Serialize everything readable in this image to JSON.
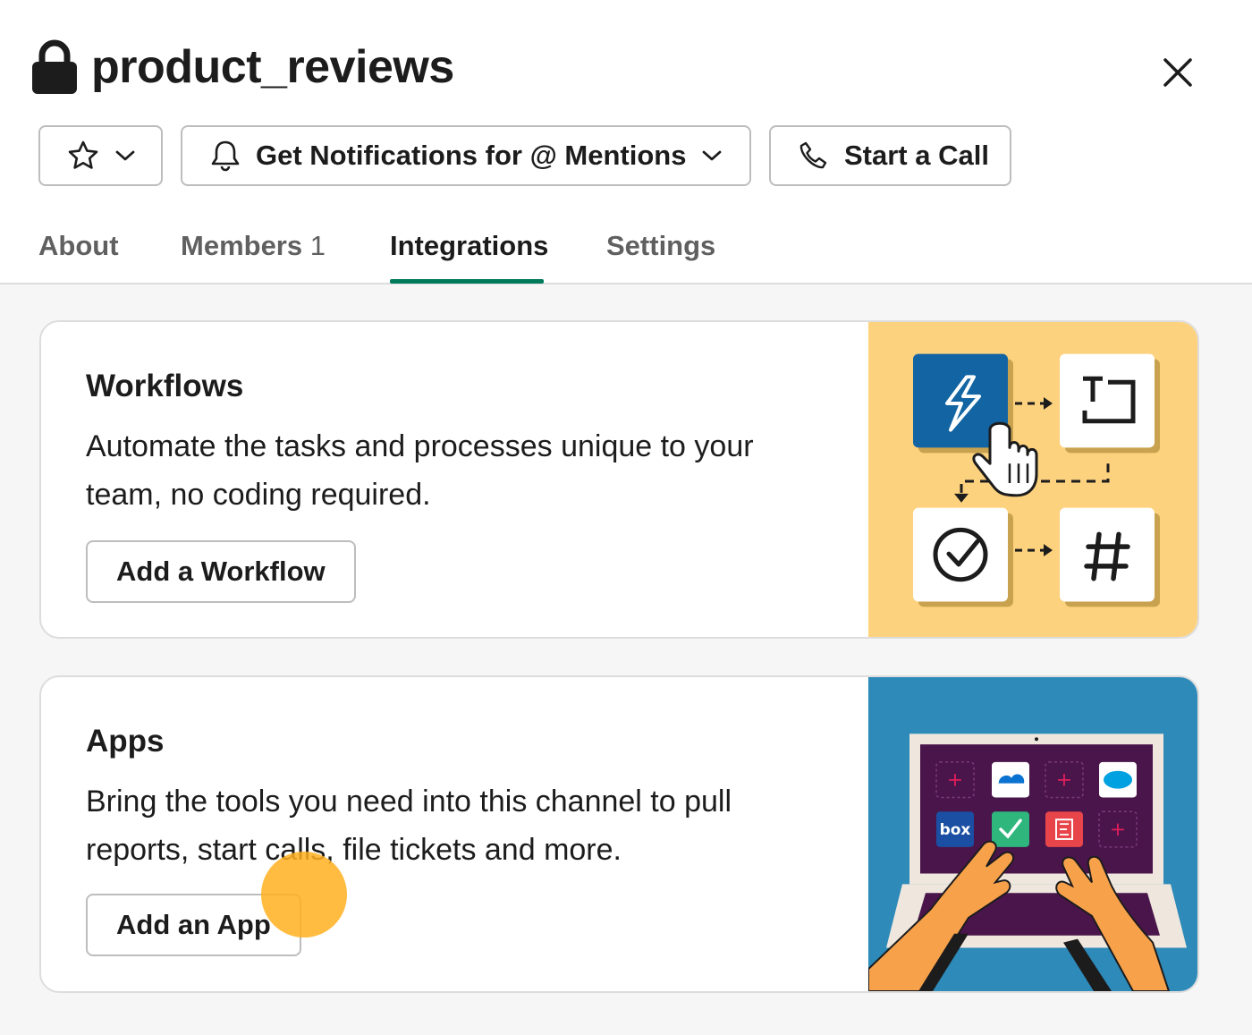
{
  "channel": {
    "title": "product_reviews",
    "is_private": true
  },
  "actions": {
    "star_icon": "star-icon",
    "notifications_label": "Get Notifications for @ Mentions",
    "call_label": "Start a Call"
  },
  "tabs": [
    {
      "label": "About",
      "active": false
    },
    {
      "label": "Members",
      "count": "1",
      "active": false
    },
    {
      "label": "Integrations",
      "active": true
    },
    {
      "label": "Settings",
      "active": false
    }
  ],
  "workflows": {
    "title": "Workflows",
    "description": "Automate the tasks and processes unique to your team, no coding required.",
    "button_label": "Add a Workflow"
  },
  "apps": {
    "title": "Apps",
    "description": "Bring the tools you need into this channel to pull reports, start calls, file tickets and more.",
    "button_label": "Add an App",
    "tile_box_label": "box"
  },
  "colors": {
    "accent_green": "#007a5a",
    "workflow_bg": "#fdd27e",
    "workflow_blue": "#1264a3",
    "apps_bg": "#2d8ab9",
    "laptop_screen": "#4a154b",
    "cursor_highlight": "#ffb01e"
  }
}
